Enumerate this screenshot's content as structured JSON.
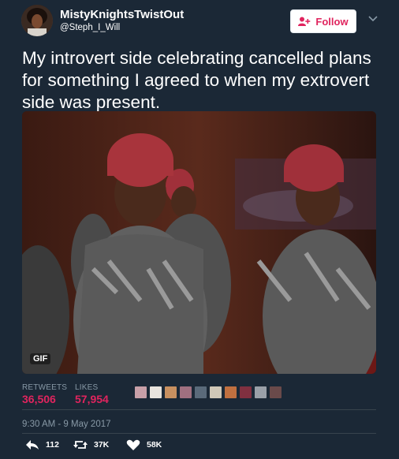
{
  "user": {
    "display_name": "MistyKnightsTwistOut",
    "handle": "@Steph_I_Will",
    "avatar_icon": "profile-photo"
  },
  "header": {
    "follow_label": "Follow",
    "follow_icon": "add-user-icon",
    "menu_icon": "chevron-down-icon"
  },
  "tweet": {
    "text": "My introvert side celebrating cancelled plans for something I agreed to when my extrovert side was present."
  },
  "media": {
    "badge": "GIF"
  },
  "stats": {
    "retweets_label": "RETWEETS",
    "retweets_value": "36,506",
    "likes_label": "LIKES",
    "likes_value": "57,954",
    "liker_avatar_count": 10
  },
  "meta": {
    "timestamp": "9:30 AM - 9 May 2017"
  },
  "actions": {
    "reply_count": "112",
    "retweet_count": "37K",
    "like_count": "58K"
  },
  "colors": {
    "background": "#1b2836",
    "accent": "#e0245e",
    "muted": "#8899a6",
    "divider": "#38444d"
  }
}
